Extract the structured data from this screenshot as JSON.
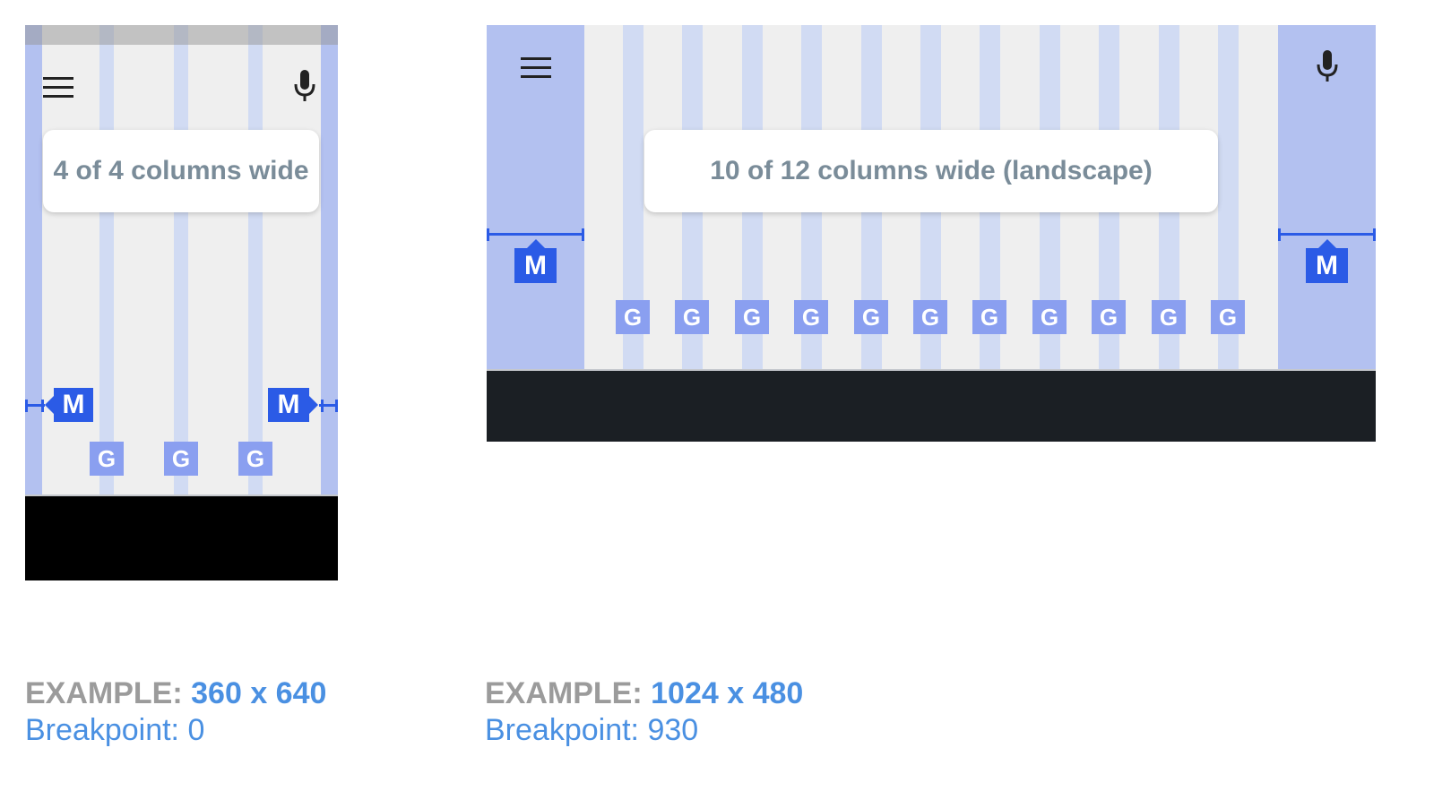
{
  "left_example": {
    "card_text": "4 of 4 columns wide",
    "margin_label": "M",
    "gutter_label": "G",
    "caption_key": "EXAMPLE:",
    "caption_value": "360 x 640",
    "breakpoint_text": "Breakpoint: 0",
    "icons": [
      "menu-icon",
      "microphone-icon"
    ]
  },
  "right_example": {
    "card_text": "10 of 12 columns wide (landscape)",
    "margin_label": "M",
    "gutter_label": "G",
    "caption_key": "EXAMPLE:",
    "caption_value": "1024 x 480",
    "breakpoint_text": "Breakpoint: 930",
    "icons": [
      "menu-icon",
      "microphone-icon"
    ]
  },
  "colors": {
    "margin": "#b3c1f0",
    "gutter": "#d1dbf3",
    "badge_margin": "#2b5be6",
    "badge_gutter": "#8a9ff0",
    "label_gray": "#9b9b9b",
    "label_blue": "#4a90e2"
  }
}
